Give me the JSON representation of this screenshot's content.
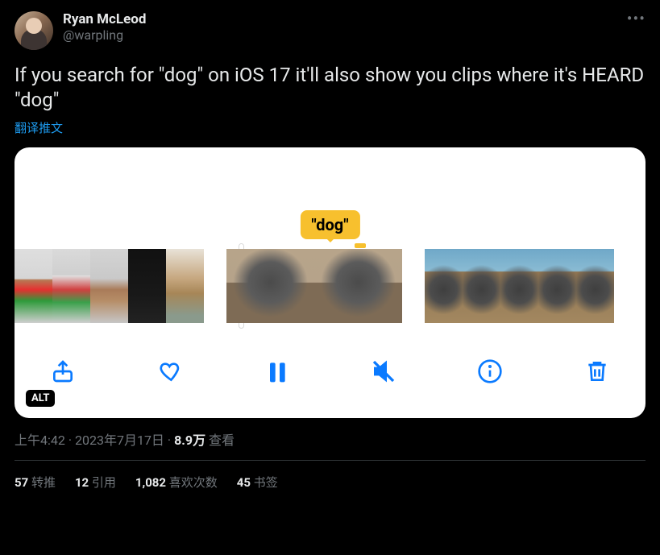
{
  "author": {
    "display_name": "Ryan McLeod",
    "handle": "@warpling"
  },
  "tweet_text": "If you search for \"dog\" on iOS 17 it'll also show you clips where it's HEARD \"dog\"",
  "translate_label": "翻译推文",
  "media": {
    "search_term": "\"dog\"",
    "alt_badge": "ALT"
  },
  "meta": {
    "time": "上午4:42",
    "dot1": " · ",
    "date": "2023年7月17日",
    "dot2": " · ",
    "views_count": "8.9万",
    "views_label": " 查看"
  },
  "stats": {
    "retweets": {
      "count": "57",
      "label": " 转推"
    },
    "quotes": {
      "count": "12",
      "label": " 引用"
    },
    "likes": {
      "count": "1,082",
      "label": " 喜欢次数"
    },
    "bookmarks": {
      "count": "45",
      "label": " 书签"
    }
  }
}
